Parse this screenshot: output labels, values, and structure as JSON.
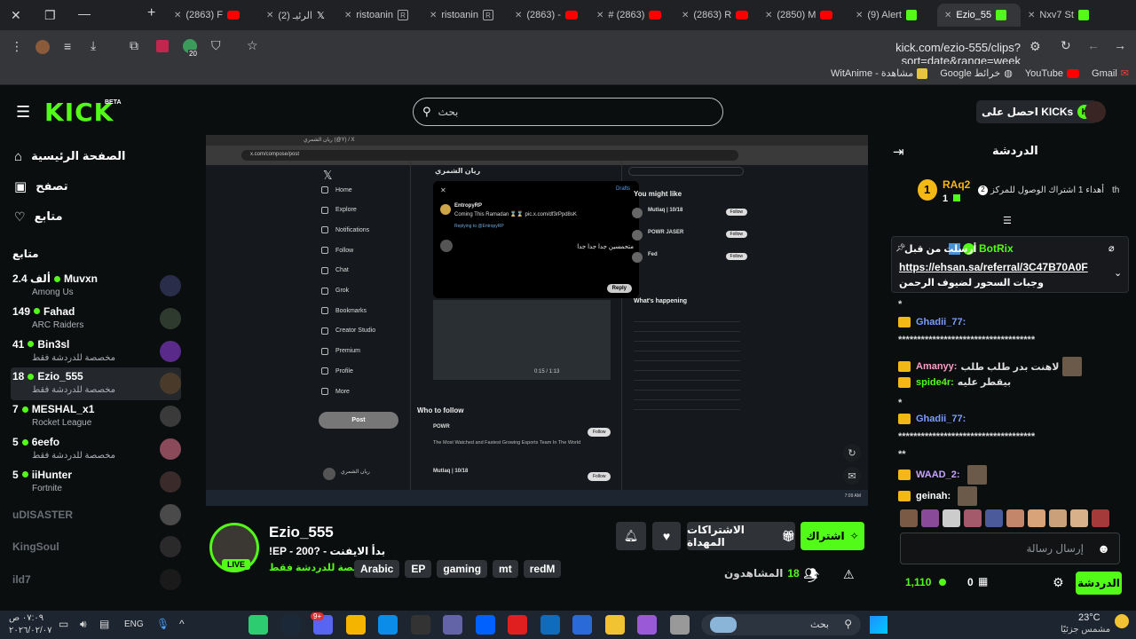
{
  "browser": {
    "tabs": [
      {
        "label": "(2863) F",
        "fav": "youtube"
      },
      {
        "label": "(2) الرئيـ",
        "fav": "x"
      },
      {
        "label": "ristoanin",
        "fav": "r"
      },
      {
        "label": "ristoanin",
        "fav": "r"
      },
      {
        "label": "(2863) -",
        "fav": "youtube"
      },
      {
        "label": "# (2863)",
        "fav": "youtube"
      },
      {
        "label": "(2863) R",
        "fav": "youtube"
      },
      {
        "label": "(2850) M",
        "fav": "youtube"
      },
      {
        "label": "(9) Alert",
        "fav": "alert"
      },
      {
        "label": "Ezio_55",
        "fav": "kick"
      },
      {
        "label": "Nxv7 St",
        "fav": "kick"
      }
    ],
    "url": "kick.com/ezio-555/clips?sort=date&range=week",
    "extension_badge": "20",
    "bookmarks": [
      {
        "label": "مشاهدة - WitAnime"
      },
      {
        "label": "خرائط Google"
      },
      {
        "label": "YouTube"
      },
      {
        "label": "Gmail"
      }
    ]
  },
  "kick": {
    "logo": "KICK",
    "logo_badge": "BETA",
    "search_placeholder": "بحث",
    "get_kicks": "احصل على KICKs"
  },
  "sidebar": {
    "nav": [
      {
        "label": "الصفحة الرئيسية",
        "icon": "home-icon"
      },
      {
        "label": "تصفح",
        "icon": "browse-icon"
      },
      {
        "label": "متابع",
        "icon": "heart-icon"
      }
    ],
    "following_title": "متابع",
    "following": [
      {
        "name": "Muvxn",
        "viewers": "2.4 ألف",
        "sub": "Among Us",
        "live": true
      },
      {
        "name": "Fahad",
        "viewers": "149",
        "sub": "ARC Raiders",
        "live": true
      },
      {
        "name": "Bin3sl",
        "viewers": "41",
        "sub": "مخصصة للدردشة فقط",
        "live": true
      },
      {
        "name": "Ezio_555",
        "viewers": "18",
        "sub": "مخصصة للدردشة فقط",
        "live": true
      },
      {
        "name": "MESHAL_x1",
        "viewers": "7",
        "sub": "Rocket League",
        "live": true
      },
      {
        "name": "6eefo",
        "viewers": "5",
        "sub": "مخصصة للدردشة فقط",
        "live": true
      },
      {
        "name": "iiHunter",
        "viewers": "5",
        "sub": "Fortnite",
        "live": true
      },
      {
        "name": "uDISASTER",
        "viewers": "",
        "sub": "",
        "live": false
      },
      {
        "name": "KingSoul",
        "viewers": "",
        "sub": "",
        "live": false
      },
      {
        "name": "ild7",
        "viewers": "",
        "sub": "",
        "live": false
      }
    ]
  },
  "video": {
    "inner_tab": "ريان الشمري (@Y) / X",
    "inner_url": "x.com/compose/post",
    "x_nav": [
      "Home",
      "Explore",
      "Notifications",
      "Follow",
      "Chat",
      "Grok",
      "Bookmarks",
      "Creator Studio",
      "Premium",
      "Profile",
      "More"
    ],
    "post_button": "Post",
    "profile_name": "ريان الشمري",
    "drafts": "Drafts",
    "quoted_user": "EntropyRP",
    "quoted_text": "Coming This Ramadan ⌛⌛ pic.x.com/df3rPpd8sK",
    "replying_to": "Replying to @EntropyRP",
    "reply_text": "متحمسين جدا جدا جدا",
    "reply_button": "Reply",
    "you_might_like": "You might like",
    "suggestions": [
      "Mutlaq | 10/18",
      "POWR JASER",
      "Fed"
    ],
    "follow_label": "Follow",
    "whats_happening": "What's happening",
    "who_to_follow": "Who to follow",
    "wtf_1": "POWR",
    "wtf_1_text": "The Most Watched and Fastest Growing Esports Team In The World",
    "wtf_2": "Mutlaq | 10/18",
    "video_time": "0:15 / 1:13",
    "clock": "7:09 AM"
  },
  "stream": {
    "name": "Ezio_555",
    "title": "!EP - 200? - بدأ الايفنت",
    "category": "مخصصة للدردشة فقط",
    "live_label": "LIVE",
    "tags": [
      "Arabic",
      "EP",
      "gaming",
      "mt",
      "redM"
    ],
    "subscribe": "اشتراك",
    "gift_subs": "الاشتراكات المهداة",
    "viewers_label": "المشاهدون",
    "viewers": "18"
  },
  "chat": {
    "title": "الدردشة",
    "gifter_name": "RAq2",
    "gifter_rank": "1",
    "gifter_count": "1",
    "gifter_text": "أهداء 1 اشتراك الوصول للمركز",
    "gifter_pos": "2",
    "gifter_tail": "th",
    "pinned_user": "BotRix",
    "pinned_prefix": "أرسلت من قبل",
    "pinned_link": "https://ehsan.sa/referral/3C47B70A0F",
    "pinned_text": "وجبات السحور لضيوف الرحمن",
    "messages": [
      {
        "user": "",
        "text": "*"
      },
      {
        "user": "Ghadii_77:",
        "text": "",
        "color": "#7d9cff"
      },
      {
        "user": "",
        "text": "************************************"
      },
      {
        "user": "Amanyy:",
        "text": "لاهنت بدر طلب طلب",
        "color": "#ff9ec5"
      },
      {
        "user": "spide4r:",
        "text": "بيقطر عليه",
        "color": "#53fc18"
      },
      {
        "user": "",
        "text": "*"
      },
      {
        "user": "Ghadii_77:",
        "text": "",
        "color": "#7d9cff"
      },
      {
        "user": "",
        "text": "************************************"
      },
      {
        "user": "",
        "text": "**"
      },
      {
        "user": "WAAD_2:",
        "text": "",
        "color": "#c7a2ff"
      },
      {
        "user": "geinah:",
        "text": "",
        "color": "#ffffff"
      }
    ],
    "input_placeholder": "إرسال رسالة",
    "points": "1,110",
    "kicks": "0",
    "send": "الدردشة"
  },
  "taskbar": {
    "time": "٠٧:٠٩ ص",
    "date": "٢٠٢٦/٠٢/٠٧",
    "lang": "ENG",
    "search": "بحث",
    "weather_temp": "23°C",
    "weather_text": "مشمس جزئيًا",
    "notif_badge": "9+"
  },
  "colors": {
    "kick_green": "#53fc18",
    "bg": "#0b0e0f"
  }
}
